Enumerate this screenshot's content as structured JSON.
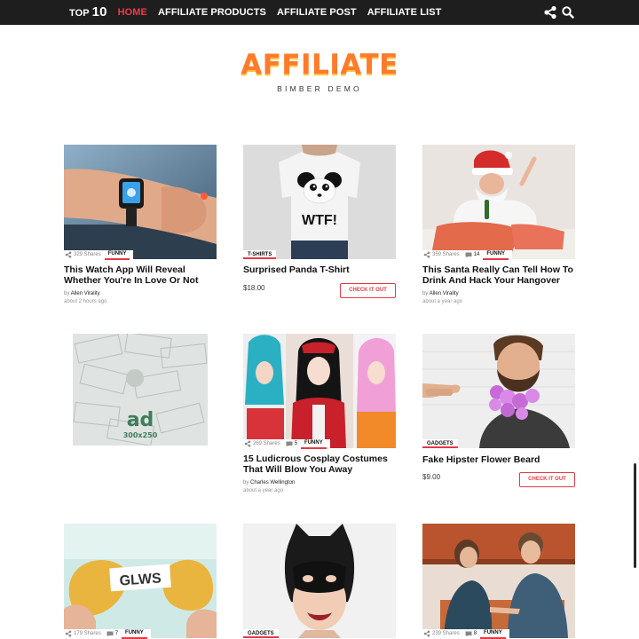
{
  "nav": {
    "top_prefix": "TOP",
    "top_number": "10",
    "items": [
      "HOME",
      "AFFILIATE PRODUCTS",
      "AFFILIATE POST",
      "AFFILIATE LIST"
    ],
    "active": "HOME",
    "icons": [
      "share-icon",
      "search-icon"
    ]
  },
  "logo": {
    "title": "AFFILIATE",
    "subtitle": "BIMBER DEMO"
  },
  "colors": {
    "accent": "#e53946",
    "nav_background": "#1e1e1e",
    "logo_orange": "#ff7a2c",
    "logo_yellow": "#ffc53d"
  },
  "cards": [
    {
      "title": "This Watch App Will Reveal Whether You're In Love Or Not",
      "shares": "329 Shares",
      "category": "FUNNY",
      "by": "by",
      "author": "Allen Virality",
      "time": "about 2 hours ago"
    },
    {
      "title": "Surprised Panda T-Shirt",
      "category": "T-SHIRTS",
      "price": "$18.00",
      "cta": "CHECK IT OUT"
    },
    {
      "title": "This Santa Really Can Tell How To Drink And Hack Your Hangover",
      "shares": "359 Shares",
      "comments": "14",
      "category": "FUNNY",
      "by": "by",
      "author": "Allen Virality",
      "time": "about a year ago"
    },
    {
      "ad_text": "ad",
      "ad_size": "300x250"
    },
    {
      "title": "15 Ludicrous Cosplay Costumes That Will Blow You Away",
      "shares": "269 Shares",
      "comments": "5",
      "category": "FUNNY",
      "by": "by",
      "author": "Charles Wellington",
      "time": "about a year ago"
    },
    {
      "title": "Fake Hipster Flower Beard",
      "category": "GADGETS",
      "price": "$9.00",
      "cta": "CHECK IT OUT"
    },
    {
      "image_text": "GLWS",
      "shares": "179 Shares",
      "comments": "7",
      "category": "FUNNY"
    },
    {
      "category": "GADGETS"
    },
    {
      "shares": "239 Shares",
      "comments": "8",
      "category": "FUNNY"
    }
  ],
  "tshirt_print": "WTF!"
}
